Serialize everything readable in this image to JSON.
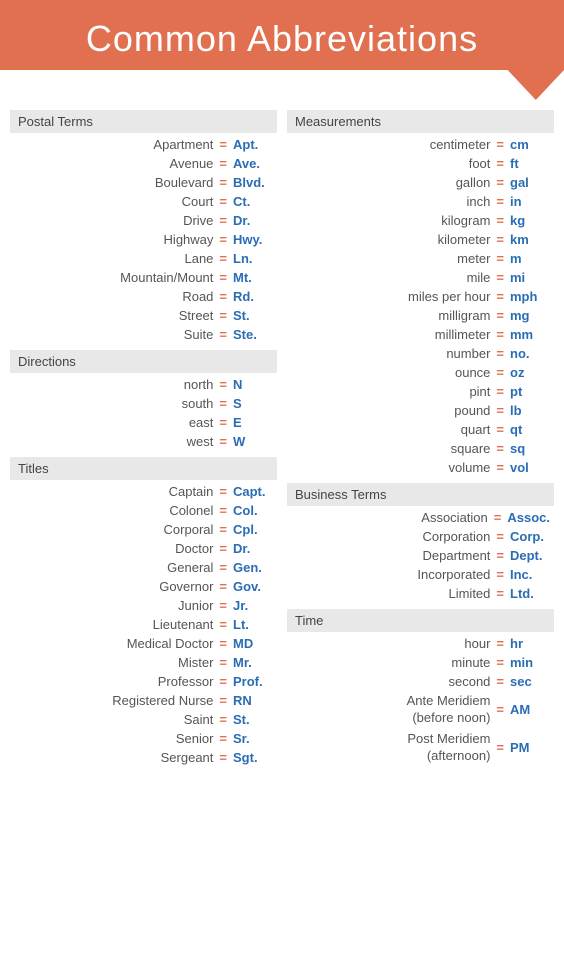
{
  "header": {
    "title": "Common Abbreviations"
  },
  "left_column": {
    "sections": [
      {
        "id": "postal",
        "header": "Postal Terms",
        "items": [
          {
            "term": "Apartment",
            "abbr": "Apt."
          },
          {
            "term": "Avenue",
            "abbr": "Ave."
          },
          {
            "term": "Boulevard",
            "abbr": "Blvd."
          },
          {
            "term": "Court",
            "abbr": "Ct."
          },
          {
            "term": "Drive",
            "abbr": "Dr."
          },
          {
            "term": "Highway",
            "abbr": "Hwy."
          },
          {
            "term": "Lane",
            "abbr": "Ln."
          },
          {
            "term": "Mountain/Mount",
            "abbr": "Mt."
          },
          {
            "term": "Road",
            "abbr": "Rd."
          },
          {
            "term": "Street",
            "abbr": "St."
          },
          {
            "term": "Suite",
            "abbr": "Ste."
          }
        ]
      },
      {
        "id": "directions",
        "header": "Directions",
        "items": [
          {
            "term": "north",
            "abbr": "N"
          },
          {
            "term": "south",
            "abbr": "S"
          },
          {
            "term": "east",
            "abbr": "E"
          },
          {
            "term": "west",
            "abbr": "W"
          }
        ]
      },
      {
        "id": "titles",
        "header": "Titles",
        "items": [
          {
            "term": "Captain",
            "abbr": "Capt."
          },
          {
            "term": "Colonel",
            "abbr": "Col."
          },
          {
            "term": "Corporal",
            "abbr": "Cpl."
          },
          {
            "term": "Doctor",
            "abbr": "Dr."
          },
          {
            "term": "General",
            "abbr": "Gen."
          },
          {
            "term": "Governor",
            "abbr": "Gov."
          },
          {
            "term": "Junior",
            "abbr": "Jr."
          },
          {
            "term": "Lieutenant",
            "abbr": "Lt."
          },
          {
            "term": "Medical Doctor",
            "abbr": "MD"
          },
          {
            "term": "Mister",
            "abbr": "Mr."
          },
          {
            "term": "Professor",
            "abbr": "Prof."
          },
          {
            "term": "Registered Nurse",
            "abbr": "RN"
          },
          {
            "term": "Saint",
            "abbr": "St."
          },
          {
            "term": "Senior",
            "abbr": "Sr."
          },
          {
            "term": "Sergeant",
            "abbr": "Sgt."
          }
        ]
      }
    ]
  },
  "right_column": {
    "sections": [
      {
        "id": "measurements",
        "header": "Measurements",
        "items": [
          {
            "term": "centimeter",
            "abbr": "cm"
          },
          {
            "term": "foot",
            "abbr": "ft"
          },
          {
            "term": "gallon",
            "abbr": "gal"
          },
          {
            "term": "inch",
            "abbr": "in"
          },
          {
            "term": "kilogram",
            "abbr": "kg"
          },
          {
            "term": "kilometer",
            "abbr": "km"
          },
          {
            "term": "meter",
            "abbr": "m"
          },
          {
            "term": "mile",
            "abbr": "mi"
          },
          {
            "term": "miles per hour",
            "abbr": "mph"
          },
          {
            "term": "milligram",
            "abbr": "mg"
          },
          {
            "term": "millimeter",
            "abbr": "mm"
          },
          {
            "term": "number",
            "abbr": "no."
          },
          {
            "term": "ounce",
            "abbr": "oz"
          },
          {
            "term": "pint",
            "abbr": "pt"
          },
          {
            "term": "pound",
            "abbr": "lb"
          },
          {
            "term": "quart",
            "abbr": "qt"
          },
          {
            "term": "square",
            "abbr": "sq"
          },
          {
            "term": "volume",
            "abbr": "vol"
          }
        ]
      },
      {
        "id": "business",
        "header": "Business Terms",
        "items": [
          {
            "term": "Association",
            "abbr": "Assoc."
          },
          {
            "term": "Corporation",
            "abbr": "Corp."
          },
          {
            "term": "Department",
            "abbr": "Dept."
          },
          {
            "term": "Incorporated",
            "abbr": "Inc."
          },
          {
            "term": "Limited",
            "abbr": "Ltd."
          }
        ]
      },
      {
        "id": "time",
        "header": "Time",
        "items": [
          {
            "term": "hour",
            "abbr": "hr"
          },
          {
            "term": "minute",
            "abbr": "min"
          },
          {
            "term": "second",
            "abbr": "sec"
          }
        ],
        "multi_items": [
          {
            "term_line1": "Ante Meridiem",
            "term_line2": "(before noon)",
            "abbr": "AM"
          },
          {
            "term_line1": "Post Meridiem",
            "term_line2": "(afternoon)",
            "abbr": "PM"
          }
        ]
      }
    ]
  },
  "equals_label": "="
}
